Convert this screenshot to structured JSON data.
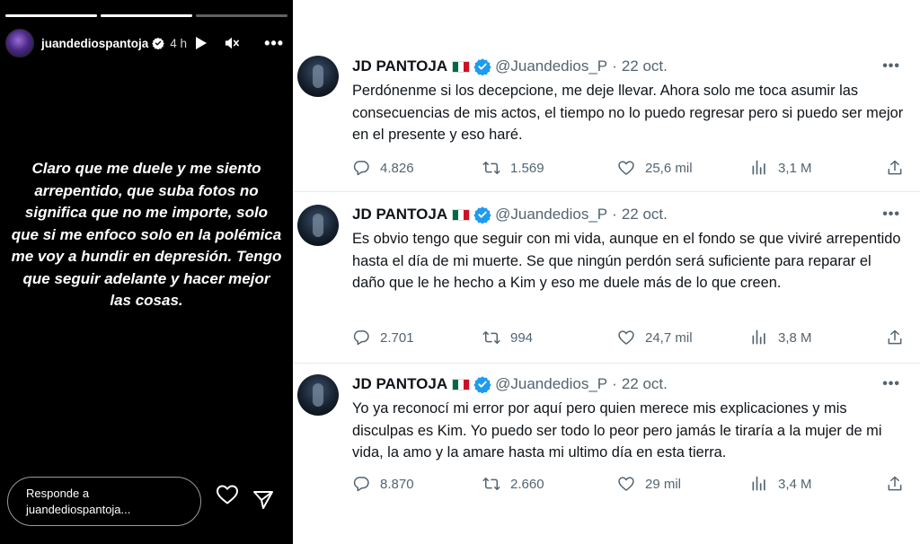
{
  "story": {
    "progress": [
      1,
      1,
      0
    ],
    "username": "juandediospantoja",
    "time": "4 h",
    "text": "Claro que me duele y me siento arrepentido, que suba fotos no significa que no me importe, solo que si me enfoco solo en la polémica me voy a hundir en depresión. Tengo que seguir adelante y hacer mejor las cosas.",
    "reply_line1": "Responde a",
    "reply_line2": "juandediospantoja..."
  },
  "tweets": [
    {
      "name": "JD PANTOJA",
      "handle": "@Juandedios_P",
      "dot": "·",
      "date": "22 oct.",
      "text": "Perdónenme si los decepcione, me deje llevar. Ahora solo me toca asumir las consecuencias de mis actos, el tiempo no lo puedo regresar pero si puedo ser mejor en el presente y eso haré.",
      "replies": "4.826",
      "retweets": "1.569",
      "likes": "25,6 mil",
      "views": "3,1 M"
    },
    {
      "name": "JD PANTOJA",
      "handle": "@Juandedios_P",
      "dot": "·",
      "date": "22 oct.",
      "text": "Es obvio tengo que seguir con mi vida, aunque en el fondo se que viviré arrepentido hasta el día de mi muerte.  Se que ningún perdón será suficiente para reparar el daño que le he hecho a Kim y eso me duele más de lo que creen.",
      "replies": "2.701",
      "retweets": "994",
      "likes": "24,7 mil",
      "views": "3,8 M"
    },
    {
      "name": "JD PANTOJA",
      "handle": "@Juandedios_P",
      "dot": "·",
      "date": "22 oct.",
      "text": "Yo ya reconocí mi error por aquí pero quien merece mis explicaciones y mis disculpas es Kim. Yo puedo ser todo lo peor pero jamás le tiraría a la mujer de mi vida, la amo y la amare hasta mi ultimo día en esta tierra.",
      "replies": "8.870",
      "retweets": "2.660",
      "likes": "29 mil",
      "views": "3,4 M"
    }
  ],
  "icons": {
    "verified": "verified-badge-icon",
    "flag": "mexico-flag-icon",
    "reply": "reply-icon",
    "retweet": "retweet-icon",
    "like": "heart-icon",
    "views": "views-icon",
    "share": "share-icon"
  },
  "colors": {
    "story_bg": "#000000",
    "verified_blue": "#1d9bf0",
    "tweet_text": "#0f1419",
    "tweet_muted": "#536471",
    "flag_green": "#006847",
    "flag_red": "#ce1126"
  }
}
